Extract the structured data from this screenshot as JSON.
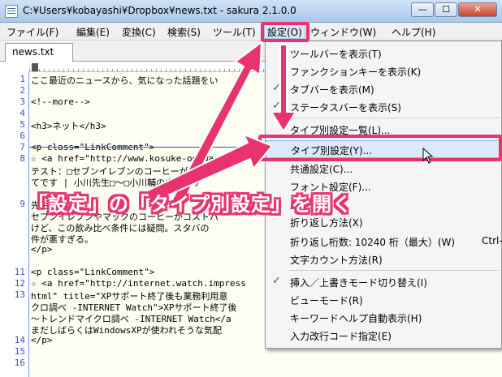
{
  "window": {
    "title": "C:¥Users¥kobayashi¥Dropbox¥news.txt - sakura 2.1.0.0",
    "min_glyph": "—",
    "max_glyph": "☐",
    "close_glyph": "✕"
  },
  "menubar": [
    {
      "label": "ファイル(F)"
    },
    {
      "label": "編集(E)"
    },
    {
      "label": "変換(C)"
    },
    {
      "label": "検索(S)"
    },
    {
      "label": "ツール(T)"
    },
    {
      "label": "設定(O)"
    },
    {
      "label": "ウィンドウ(W)"
    },
    {
      "label": "ヘルプ(H)"
    }
  ],
  "tab": {
    "label": "news.txt"
  },
  "editor": {
    "line_numbers": [
      "1",
      "2",
      "3",
      "4",
      "5",
      "6",
      "7",
      "8",
      "",
      "",
      "",
      "9",
      "",
      "",
      "",
      "",
      "",
      "11",
      "12",
      "13",
      "",
      "",
      "",
      "14",
      "15",
      "16"
    ],
    "lines": [
      "ここ最近のニュースから、気になった話題をい",
      "",
      "<!--more-->",
      "",
      "<h3>ネット</h3>",
      "",
      "<p class=\"LinkComment\">",
      "☆ <a href=\"http://www.kosuke-ogawa.com/",
      "テスト：□セブンイレブンのコーヒーが圧勝し",
      "てです | 小川先生□～□小川輔のウェブサ",
      "",
      "先生",
      "セブンイレブンやマックのコーヒーがコストパ",
      "けど、この飲み比べ条件には疑問。スタバの",
      "件が悪すぎる。",
      "</p>",
      "",
      "<p class=\"LinkComment\">",
      "☆ <a href=\"http://internet.watch.impress",
      "html\" title=\"XPサポート終了後も業務利用意",
      "クロ調べ -INTERNET Watch\">XPサポート終了後",
      "～トレンドマイクロ調べ -INTERNET Watch</a",
      "まだしばらくはWindowsXPが使われそうな気配",
      "</p>",
      ""
    ]
  },
  "dropdown": {
    "items": [
      {
        "label": "ツールバーを表示(T)",
        "checked": false,
        "shortcut": ""
      },
      {
        "label": "ファンクションキーを表示(K)",
        "checked": false,
        "shortcut": ""
      },
      {
        "label": "タブバーを表示(M)",
        "checked": true,
        "shortcut": ""
      },
      {
        "label": "ステータスバーを表示(S)",
        "checked": true,
        "shortcut": ""
      },
      {
        "label": "タイプ別設定一覧(L)...",
        "checked": false,
        "shortcut": ""
      },
      {
        "label": "タイプ別設定(Y)...",
        "checked": false,
        "shortcut": ""
      },
      {
        "label": "共通設定(C)...",
        "checked": false,
        "shortcut": ""
      },
      {
        "label": "フォント設定(F)...",
        "checked": false,
        "shortcut": ""
      },
      {
        "label": "履",
        "checked": false,
        "shortcut": ""
      },
      {
        "label": "折り返し方法(X)",
        "checked": false,
        "shortcut": ""
      },
      {
        "label": "折り返し桁数: 10240 桁（最大）(W)",
        "checked": false,
        "shortcut": "Ctrl-"
      },
      {
        "label": "文字カウント方法(R)",
        "checked": false,
        "shortcut": ""
      },
      {
        "label": "挿入／上書きモード切り替え(I)",
        "checked": true,
        "shortcut": ""
      },
      {
        "label": "ビューモード(R)",
        "checked": false,
        "shortcut": ""
      },
      {
        "label": "キーワードヘルプ自動表示(H)",
        "checked": false,
        "shortcut": ""
      },
      {
        "label": "入力改行コード指定(E)",
        "checked": false,
        "shortcut": ""
      }
    ],
    "check_glyph": "✓"
  },
  "annotation": {
    "banner_text": "「設定」の「タイプ別設定」を開く",
    "color": "#e8336f"
  },
  "colors": {
    "editor_bg": "#fffef3",
    "line_number": "#3a55c8",
    "accent": "#e8336f"
  }
}
